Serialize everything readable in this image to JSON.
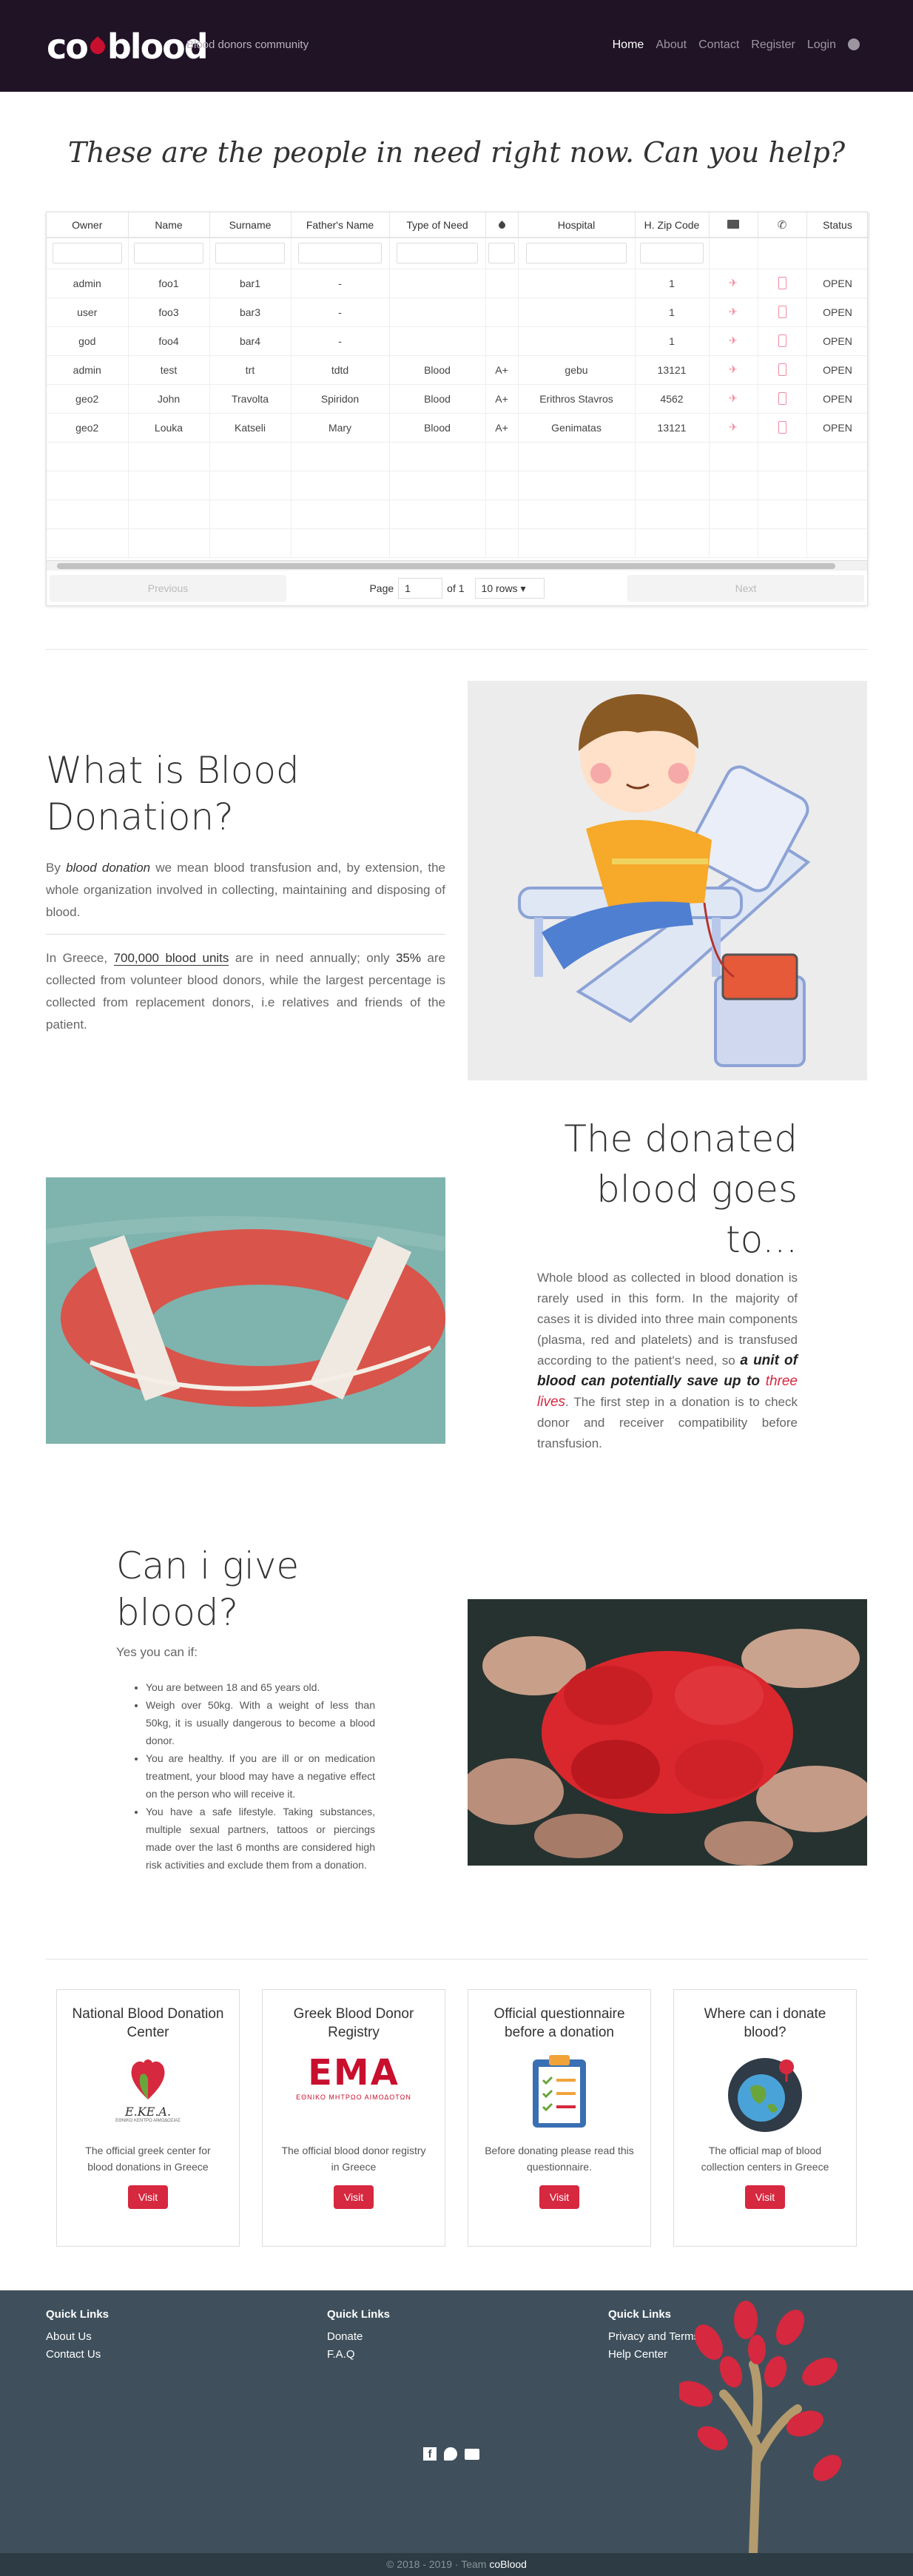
{
  "nav": {
    "brand": "coblood",
    "tagline": "Blood donors community",
    "links": [
      "Home",
      "About",
      "Contact",
      "Register",
      "Login"
    ],
    "help_icon": "question-circle-icon"
  },
  "hero_title": "These are the people in need right now. Can you help?",
  "table": {
    "columns": [
      "Owner",
      "Name",
      "Surname",
      "Father's Name",
      "Type of Need",
      "",
      "Hospital",
      "H. Zip Code",
      "",
      "",
      "Status"
    ],
    "column_icons": [
      "",
      "",
      "",
      "",
      "",
      "blood-drop-icon",
      "",
      "",
      "envelope-icon",
      "phone-icon",
      ""
    ],
    "rows": [
      [
        "admin",
        "foo1",
        "bar1",
        "-",
        "",
        "",
        "",
        "1",
        "OPEN"
      ],
      [
        "user",
        "foo3",
        "bar3",
        "-",
        "",
        "",
        "",
        "1",
        "OPEN"
      ],
      [
        "god",
        "foo4",
        "bar4",
        "-",
        "",
        "",
        "",
        "1",
        "OPEN"
      ],
      [
        "admin",
        "test",
        "trt",
        "tdtd",
        "Blood",
        "A+",
        "gebu",
        "13121",
        "OPEN"
      ],
      [
        "geo2",
        "John",
        "Travolta",
        "Spiridon",
        "Blood",
        "A+",
        "Erithros Stavros",
        "4562",
        "OPEN"
      ],
      [
        "geo2",
        "Louka",
        "Katseli",
        "Mary",
        "Blood",
        "A+",
        "Genimatas",
        "13121",
        "OPEN"
      ]
    ],
    "pager": {
      "previous": "Previous",
      "page_label": "Page",
      "page": "1",
      "of": "of 1",
      "rows": "10 rows",
      "next": "Next"
    }
  },
  "what": {
    "title": "What is Blood Donation?",
    "p1_a": "By ",
    "p1_em": "blood donation",
    "p1_b": " we mean blood transfusion and, by extension, the whole organization involved in collecting, maintaining and disposing of blood.",
    "p2_a": "In Greece, ",
    "p2_u": "700,000 blood units",
    "p2_b": " are in need annually; only ",
    "p2_pct": "35%",
    "p2_c": " are collected from volunteer blood donors, while the largest percentage is collected from replacement donors, i.e relatives and friends of the patient."
  },
  "goes": {
    "title": "The donated blood goes to...",
    "p_a": "Whole blood as collected in blood donation is rarely used in this form. In the majority of cases it is divided into three main components (plasma, red and platelets) and is transfused according to the patient's need, so ",
    "p_em": "a unit of blood can potentially save up to ",
    "p_red": "three lives",
    "p_b": ". The first step in a donation is to check donor and receiver compatibility before transfusion."
  },
  "give": {
    "title": "Can i give blood?",
    "intro": "Yes you can if:",
    "items": [
      "You are between 18 and 65 years old.",
      "Weigh over 50kg. With a weight of less than 50kg, it is usually dangerous to become a blood donor.",
      "You are healthy. If you are ill or on medication treatment, your blood may have a negative effect on the person who will receive it.",
      "You have a safe lifestyle. Taking substances, multiple sexual partners, tattoos or piercings made over the last 6 months are considered high risk activities and exclude them from a donation."
    ]
  },
  "cards": [
    {
      "title": "National Blood Donation Center",
      "logo_text": "Ε.ΚΕ.Α.",
      "logo_sub": "ΕΘΝΙΚΟ ΚΕΝΤΡΟ ΑΙΜΟΔΟΣΙΑΣ",
      "text": "The official greek center for blood donations in Greece",
      "button": "Visit"
    },
    {
      "title": "Greek Blood Donor Registry",
      "logo_text": "ΕΜΑ",
      "logo_sub": "ΕΘΝΙΚΟ ΜΗΤΡΩΟ ΑΙΜΟΔΟΤΩΝ",
      "text": "The official blood donor registry in Greece",
      "button": "Visit"
    },
    {
      "title": "Official questionnaire before a donation",
      "logo_text": "",
      "logo_sub": "",
      "text": "Before donating please read this questionnaire.",
      "button": "Visit"
    },
    {
      "title": "Where can i donate blood?",
      "logo_text": "",
      "logo_sub": "",
      "text": "The official map of blood collection centers in Greece",
      "button": "Visit"
    }
  ],
  "footer": {
    "columns": [
      {
        "heading": "Quick Links",
        "links": [
          "About Us",
          "Contact Us"
        ]
      },
      {
        "heading": "Quick Links",
        "links": [
          "Donate",
          "F.A.Q"
        ]
      },
      {
        "heading": "Quick Links",
        "links": [
          "Privacy and Terms",
          "Help Center"
        ]
      }
    ],
    "social_icons": [
      "facebook-icon",
      "twitter-icon",
      "envelope-icon"
    ],
    "copyright": "© 2018 - 2019 · Team ",
    "team": "coBlood"
  },
  "colors": {
    "nav_bg": "#201325",
    "accent": "#d6283f",
    "footer_bg": "#3f505c"
  }
}
